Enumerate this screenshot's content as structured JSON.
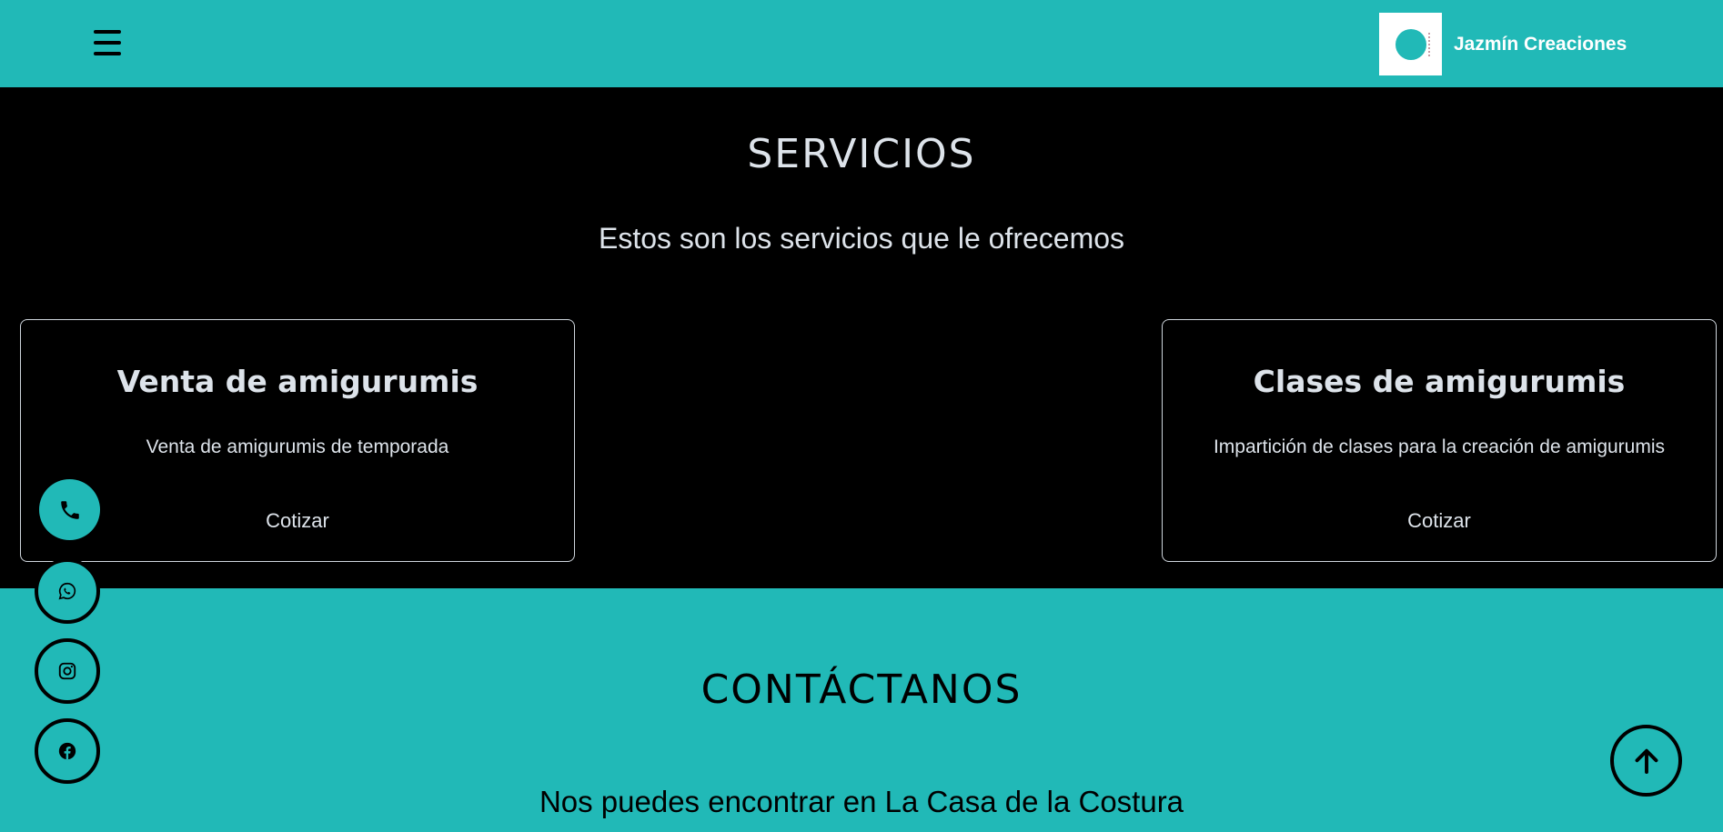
{
  "header": {
    "brand_name": "Jazmín Creaciones",
    "logo_text": "Jazmin",
    "menu_icon": "hamburger-icon"
  },
  "servicios": {
    "title": "SERVICIOS",
    "subtitle": "Estos son los servicios que le ofrecemos",
    "cards": [
      {
        "title": "Venta de amigurumis",
        "text": "Venta de amigurumis de temporada",
        "link": "Cotizar"
      },
      {
        "title": "Clases de amigurumis",
        "text": "Impartición de clases para la creación de amigurumis",
        "link": "Cotizar"
      }
    ]
  },
  "contacto": {
    "title": "CONTÁCTANOS",
    "subtitle": "Nos puedes encontrar en La Casa de la Costura"
  },
  "floating_buttons": [
    "phone-icon",
    "whatsapp-icon",
    "instagram-icon",
    "facebook-icon"
  ],
  "scroll_top_icon": "arrow-up-icon",
  "colors": {
    "accent": "#21b9b7",
    "background": "#000000",
    "text_light": "#dde3ea"
  }
}
